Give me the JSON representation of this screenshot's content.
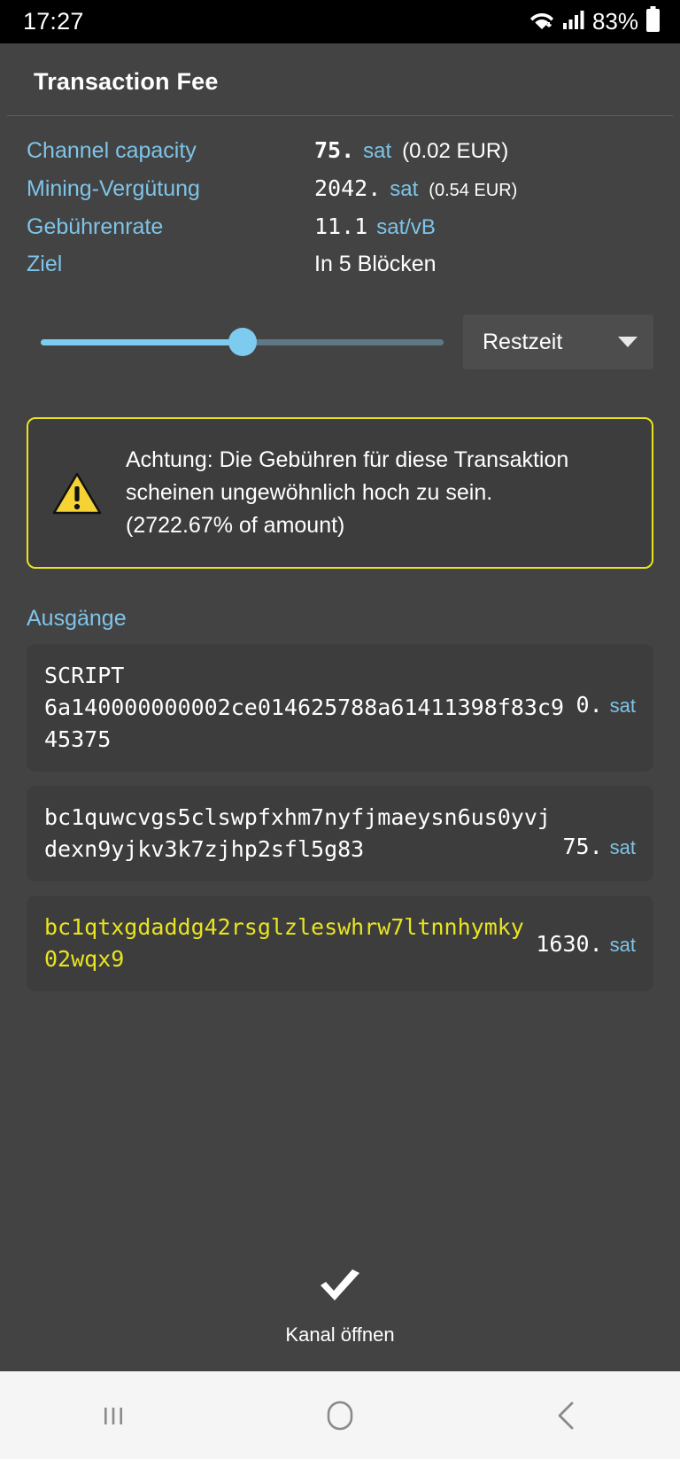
{
  "status_bar": {
    "time": "17:27",
    "battery_percent": "83%",
    "icons": [
      "wifi-icon",
      "signal-icon",
      "battery-icon"
    ]
  },
  "header": {
    "title": "Transaction Fee"
  },
  "details": {
    "rows": [
      {
        "label": "Channel capacity",
        "amount": "75.",
        "bold": true,
        "unit": "sat",
        "fiat": "(0.02 EUR)",
        "fiat_small": false
      },
      {
        "label": "Mining-Vergütung",
        "amount": "2042.",
        "bold": false,
        "unit": "sat",
        "fiat": "(0.54 EUR)",
        "fiat_small": true
      },
      {
        "label": "Gebührenrate",
        "amount": "11.1",
        "bold": false,
        "unit": "sat/vB",
        "fiat": "",
        "fiat_small": false
      },
      {
        "label": "Ziel",
        "plain_value": "In 5 Blöcken"
      }
    ]
  },
  "controls": {
    "slider": {
      "value_percent": 50,
      "fill_color": "#7ecbf0",
      "track_color": "#5f7886"
    },
    "dropdown": {
      "selected": "Restzeit",
      "icon": "chevron-down-icon"
    }
  },
  "warning": {
    "icon": "warning-triangle-icon",
    "border_color": "#e8e420",
    "line1": "Achtung: Die Gebühren für diese Transaktion",
    "line2": "scheinen ungewöhnlich hoch zu sein.",
    "line3": "(2722.67% of amount)"
  },
  "outputs": {
    "heading": "Ausgänge",
    "items": [
      {
        "kind": "script",
        "label": "SCRIPT",
        "text": "6a140000000002ce014625788a61411398f83c945375",
        "amount": "0.",
        "unit": "sat",
        "highlight": false
      },
      {
        "kind": "address",
        "label": "",
        "text": "bc1quwcvgs5clswpfxhm7nyfjmaeysn6us0yvjdexn9yjkv3k7zjhp2sfl5g83",
        "amount": "75.",
        "unit": "sat",
        "highlight": false
      },
      {
        "kind": "address",
        "label": "",
        "text": "bc1qtxgdaddg42rsglzleswhrw7ltnnhymky02wqx9",
        "amount": "1630.",
        "unit": "sat",
        "highlight": true
      }
    ]
  },
  "action": {
    "icon": "checkmark-icon",
    "label": "Kanal öffnen"
  },
  "navigation_bar": {
    "recents": "recents-icon",
    "home": "home-icon",
    "back": "back-icon"
  },
  "colors": {
    "accent_blue": "#7ec4e8",
    "warning_yellow": "#e8e420",
    "background": "#434343",
    "card": "#3d3d3d"
  }
}
